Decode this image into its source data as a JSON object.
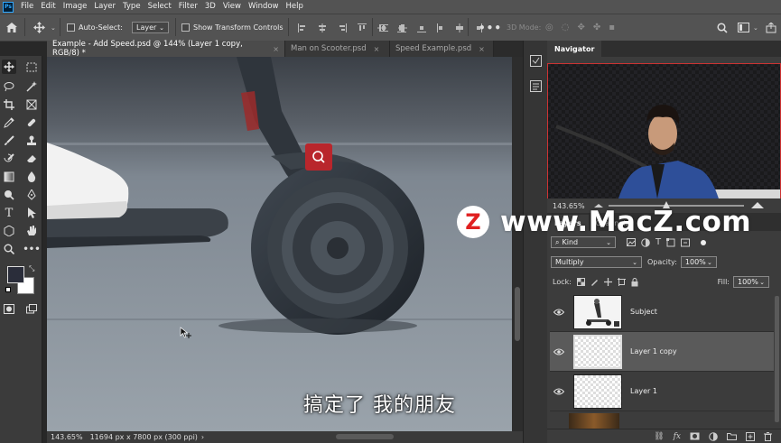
{
  "menu": [
    "File",
    "Edit",
    "Image",
    "Layer",
    "Type",
    "Select",
    "Filter",
    "3D",
    "View",
    "Window",
    "Help"
  ],
  "options": {
    "auto_select_label": "Auto-Select:",
    "auto_select_value": "Layer",
    "show_transform_label": "Show Transform Controls",
    "mode_3d_label": "3D Mode:"
  },
  "tabs": [
    {
      "label": "Example - Add Speed.psd @ 144% (Layer 1 copy, RGB/8) *",
      "active": true
    },
    {
      "label": "Man on Scooter.psd",
      "active": false
    },
    {
      "label": "Speed Example.psd",
      "active": false
    }
  ],
  "status": {
    "zoom": "143.65%",
    "doc_info": "11694 px x 7800 px (300 ppi)"
  },
  "navigator": {
    "title": "Navigator",
    "zoom": "143.65%"
  },
  "layers_panel": {
    "tabs": [
      "Layers",
      "Channels"
    ],
    "filter_label": "Kind",
    "blend_mode": "Multiply",
    "opacity_label": "Opacity:",
    "opacity_value": "100%",
    "lock_label": "Lock:",
    "fill_label": "Fill:",
    "fill_value": "100%",
    "layers": [
      {
        "name": "Subject",
        "selected": false
      },
      {
        "name": "Layer 1 copy",
        "selected": true
      },
      {
        "name": "Layer 1",
        "selected": false
      }
    ]
  },
  "watermark": {
    "badge": "Z",
    "text": "www.MacZ.com"
  },
  "subtitle": "搞定了 我的朋友",
  "colors": {
    "foreground": "#2a2d3a",
    "background": "#ffffff",
    "accent_red": "#b9262c"
  }
}
